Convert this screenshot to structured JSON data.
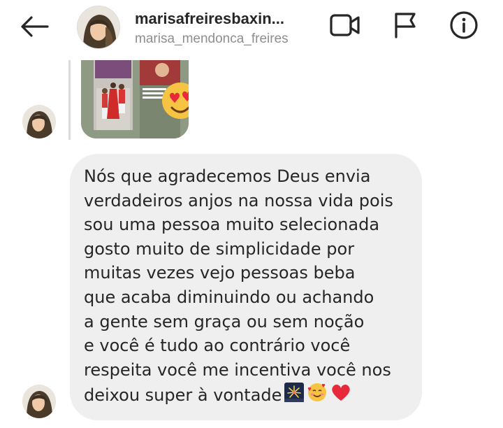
{
  "header": {
    "title": "marisafreiresbaxin...",
    "subtitle": "marisa_mendonca_freires",
    "icons": [
      "back-arrow-icon",
      "video-call-icon",
      "flag-icon",
      "info-icon"
    ]
  },
  "message": {
    "lines": [
      "Nós que agradecemos Deus envia",
      "verdadeiros anjos na nossa vida pois",
      "sou uma pessoa muito selecionada",
      "gosto muito de simplicidade por",
      "muitas vezes vejo pessoas beba",
      "que acaba diminuindo ou achando",
      "a gente sem graça ou sem noção",
      "e você é tudo ao contrário você",
      "respeita você me incentiva você nos",
      "deixou super à vontade"
    ],
    "emojis": [
      "fireworks",
      "smiling-face-with-hearts",
      "red-heart"
    ]
  },
  "colors": {
    "bubble": "#efefef",
    "text": "#262626",
    "subtitle": "#8e8e8e"
  }
}
